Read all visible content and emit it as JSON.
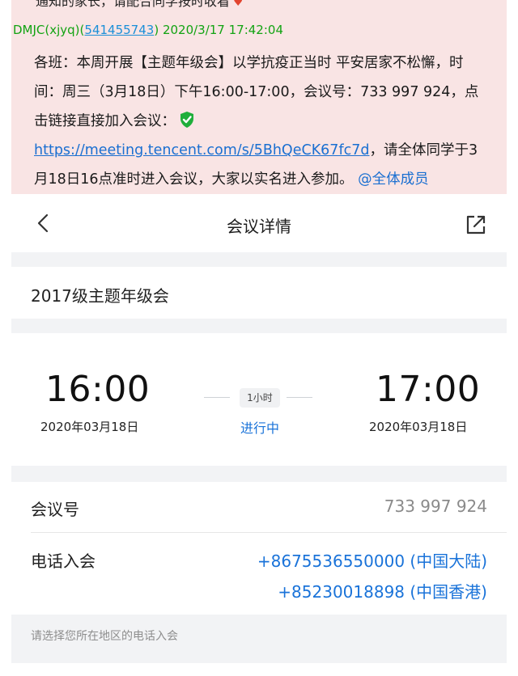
{
  "chat": {
    "cut_line": "通知的家长，请配合同学按时收看",
    "sender": "DMJC(xjyq)",
    "sender_qq": "541455743",
    "sent_time": "2020/3/17 17:42:04",
    "line1": "各班：本周开展【主题年级会】以学抗疫正当时 平安居家不松懈，时",
    "line2": "间：周三（3月18日）下午16:00-17:00，会议号：733 997 924，点",
    "line3": "击链接直接加入会议：",
    "link": "https://meeting.tencent.com/s/5BhQeCK67fc7d",
    "line4_rest": "，请全体同学于3",
    "line5": "月18日16点准时进入会议，大家以实名进入参加。",
    "mention": "@全体成员",
    "colors": {
      "bubble": "#f9e4e4",
      "sender": "#13a313",
      "link": "#1a6fd1"
    }
  },
  "header": {
    "title": "会议详情",
    "back_icon": "chevron-left-icon",
    "share_icon": "share-external-icon"
  },
  "meeting": {
    "name": "2017级主题年级会",
    "start_time": "16:00",
    "start_date": "2020年03月18日",
    "duration": "1小时",
    "status": "进行中",
    "end_time": "17:00",
    "end_date": "2020年03月18日"
  },
  "info": {
    "id_label": "会议号",
    "id_value": "733 997 924",
    "phone_label": "电话入会",
    "phones": [
      "+8675536550000 (中国大陆)",
      "+85230018898 (中国香港)"
    ],
    "tip": "请选择您所在地区的电话入会"
  },
  "colors": {
    "accent": "#1a73d9",
    "gap": "#f2f3f5"
  }
}
